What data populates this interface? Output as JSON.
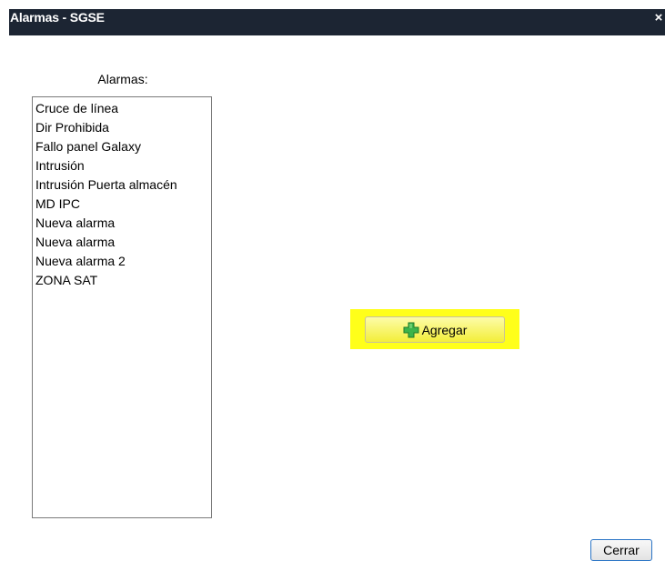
{
  "window": {
    "title": "Alarmas - SGSE",
    "close_glyph": "×"
  },
  "alarms": {
    "label": "Alarmas:",
    "items": [
      "Cruce de línea",
      "Dir Prohibida",
      "Fallo panel Galaxy",
      "Intrusión",
      "Intrusión Puerta almacén",
      "MD IPC",
      "Nueva alarma",
      "Nueva alarma",
      "Nueva alarma 2",
      "ZONA SAT"
    ]
  },
  "buttons": {
    "add_label": "Agregar",
    "add_icon": "plus-icon",
    "close_label": "Cerrar"
  },
  "colors": {
    "titlebar": "#1c2533",
    "highlight": "#ffff1a",
    "plus_icon": "#3cb44a"
  }
}
